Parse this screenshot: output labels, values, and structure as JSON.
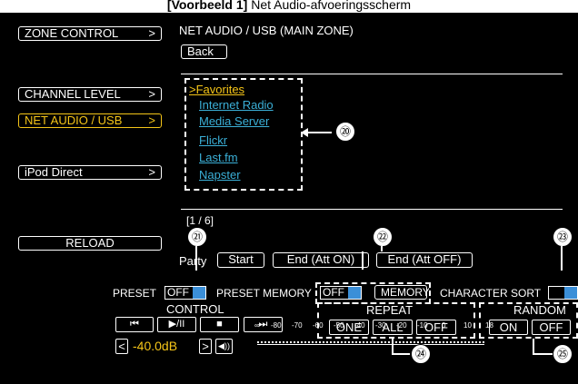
{
  "caption": {
    "bold": "[Voorbeeld 1]",
    "rest": "Net Audio-afvoeringsscherm"
  },
  "sidebar": {
    "zone_control": "ZONE CONTROL",
    "channel_level": "CHANNEL LEVEL",
    "net_audio_usb": "NET AUDIO / USB",
    "ipod_direct": "iPod Direct",
    "reload": "RELOAD",
    "arrow": ">"
  },
  "header": {
    "title": "NET AUDIO / USB (MAIN ZONE)",
    "back": "Back"
  },
  "list": {
    "items": [
      ">Favorites",
      "Internet Radio",
      "Media Server",
      "Flickr",
      "Last.fm",
      "Napster"
    ],
    "page": "[1 / 6]"
  },
  "party": {
    "label": "Party",
    "start": "Start",
    "end_on": "End (Att ON)",
    "end_off": "End (Att OFF)"
  },
  "preset": {
    "label": "PRESET",
    "value": "OFF"
  },
  "preset_memory": {
    "label": "PRESET MEMORY",
    "value": "OFF",
    "button": "MEMORY"
  },
  "character_sort": {
    "label": "CHARACTER SORT"
  },
  "control": {
    "label": "CONTROL",
    "prev": "⏮",
    "play_pause": "▶/II",
    "stop": "■",
    "next": "⏭"
  },
  "volume": {
    "down": "<",
    "value": "-40.0dB",
    "up": ">",
    "scale": [
      "∞",
      "-80",
      "-70",
      "-60",
      "-50",
      "-40",
      "-30",
      "-20",
      "-10",
      "0",
      "10",
      "18"
    ]
  },
  "repeat": {
    "label": "REPEAT",
    "one": "ONE",
    "all": "ALL",
    "off": "OFF"
  },
  "random": {
    "label": "RANDOM",
    "on": "ON",
    "off": "OFF"
  },
  "callouts": [
    "⑳",
    "㉑",
    "㉒",
    "㉓",
    "㉔",
    "㉕"
  ],
  "colors": {
    "accent": "#f5c518",
    "link": "#3bb0d8",
    "dropdown": "#3b8fd8",
    "background": "#000000"
  }
}
